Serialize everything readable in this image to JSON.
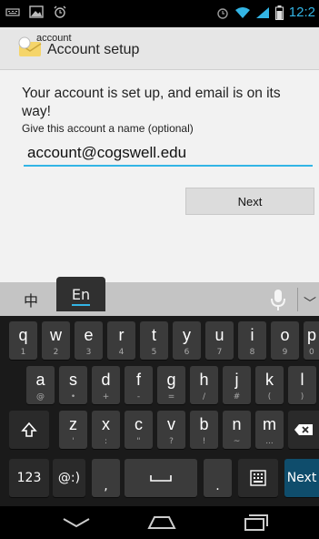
{
  "status_bar": {
    "time": "12:2",
    "left_icons": [
      "keyboard-icon",
      "image-icon",
      "alarm-icon"
    ],
    "right_icons": [
      "alarm-icon",
      "wifi-icon",
      "signal-icon",
      "battery-icon"
    ],
    "accent_color": "#33b5e5"
  },
  "action_bar": {
    "subtitle": "account",
    "title": "Account setup",
    "icon": "email-app-icon"
  },
  "content": {
    "message": "Your account is set up, and email is on its way!",
    "name_hint": "Give this account a name (optional)",
    "account_name_value": "account@cogswell.edu",
    "next_label": "Next"
  },
  "keyboard": {
    "lang_zh": "中",
    "lang_en": "En",
    "row1": [
      {
        "main": "q",
        "sub": "1"
      },
      {
        "main": "w",
        "sub": "2"
      },
      {
        "main": "e",
        "sub": "3"
      },
      {
        "main": "r",
        "sub": "4"
      },
      {
        "main": "t",
        "sub": "5"
      },
      {
        "main": "y",
        "sub": "6"
      },
      {
        "main": "u",
        "sub": "7"
      },
      {
        "main": "i",
        "sub": "8"
      },
      {
        "main": "o",
        "sub": "9"
      },
      {
        "main": "p",
        "sub": "0"
      }
    ],
    "row2": [
      {
        "main": "a",
        "sub": "@"
      },
      {
        "main": "s",
        "sub": "•"
      },
      {
        "main": "d",
        "sub": "+"
      },
      {
        "main": "f",
        "sub": "-"
      },
      {
        "main": "g",
        "sub": "="
      },
      {
        "main": "h",
        "sub": "/"
      },
      {
        "main": "j",
        "sub": "#"
      },
      {
        "main": "k",
        "sub": "("
      },
      {
        "main": "l",
        "sub": ")"
      }
    ],
    "row3": [
      {
        "main": "z",
        "sub": "'"
      },
      {
        "main": "x",
        "sub": ":"
      },
      {
        "main": "c",
        "sub": "\""
      },
      {
        "main": "v",
        "sub": "?"
      },
      {
        "main": "b",
        "sub": "!"
      },
      {
        "main": "n",
        "sub": "~"
      },
      {
        "main": "m",
        "sub": "..."
      }
    ],
    "numbers_label": "123",
    "emoji_label": "@:)",
    "comma_label": ",",
    "period_label": ".",
    "next_label": "Next",
    "next_color": "#0f4d6c"
  },
  "nav_bar": {
    "buttons": [
      "back-icon",
      "home-icon",
      "recents-icon"
    ]
  }
}
